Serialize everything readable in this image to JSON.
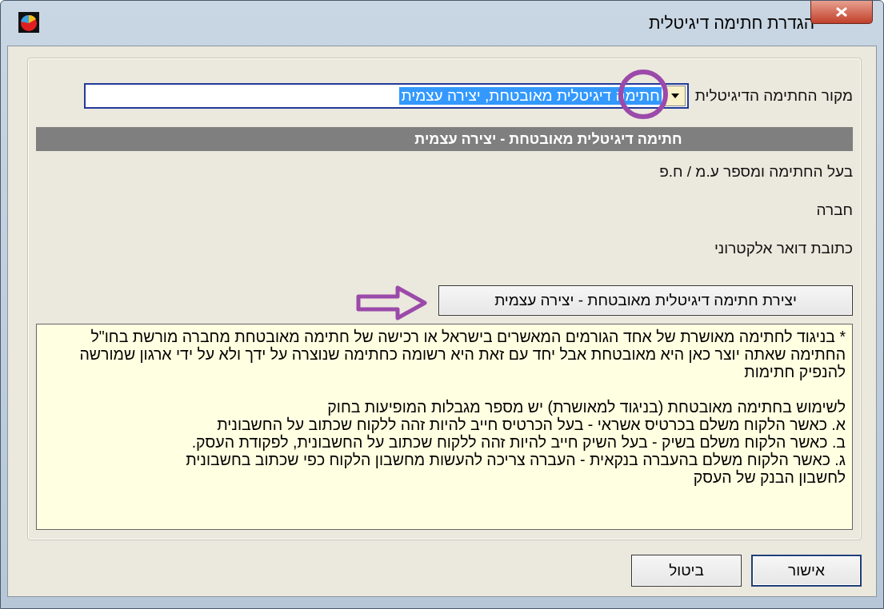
{
  "window": {
    "title": "הגדרת חתימה דיגיטלית"
  },
  "source": {
    "label": "מקור החתימה הדיגיטלית",
    "value": "חתימה דיגיטלית מאובטחת, יצירה עצמית"
  },
  "section_header": "חתימה דיגיטלית מאובטחת - יצירה עצמית",
  "fields": [
    "בעל החתימה ומספר ע.מ / ח.פ",
    "חברה",
    "כתובת דואר אלקטרוני"
  ],
  "create_button": "יצירת חתימה דיגיטלית מאובטחת - יצירה עצמית",
  "note": {
    "paragraph": "* בניגוד לחתימה מאושרת של אחד הגורמים המאשרים בישראל או רכישה של חתימה מאובטחת מחברה מורשת בחו\"ל החתימה שאתה יוצר כאן היא מאובטחת אבל יחד עם זאת היא רשומה כחתימה שנוצרה על ידך ולא על ידי ארגון שמורשה להנפיק חתימות",
    "lines": [
      "לשימוש בחתימה מאובטחת (בניגוד למאושרת) יש מספר מגבלות המופיעות בחוק",
      "א. כאשר הלקוח משלם בכרטיס אשראי - בעל הכרטיס חייב להיות זהה ללקוח שכתוב על החשבונית",
      "ב. כאשר הלקוח משלם בשיק - בעל השיק חייב להיות זהה ללקוח שכתוב על החשבונית, לפקודת העסק.",
      "ג. כאשר הלקוח משלם בהעברה בנקאית - העברה צריכה להעשות מחשבון הלקוח כפי שכתוב בחשבונית",
      "לחשבון הבנק של העסק"
    ]
  },
  "buttons": [
    {
      "label": "אישור",
      "kind": "ok"
    },
    {
      "label": "ביטול",
      "kind": "cancel"
    }
  ]
}
